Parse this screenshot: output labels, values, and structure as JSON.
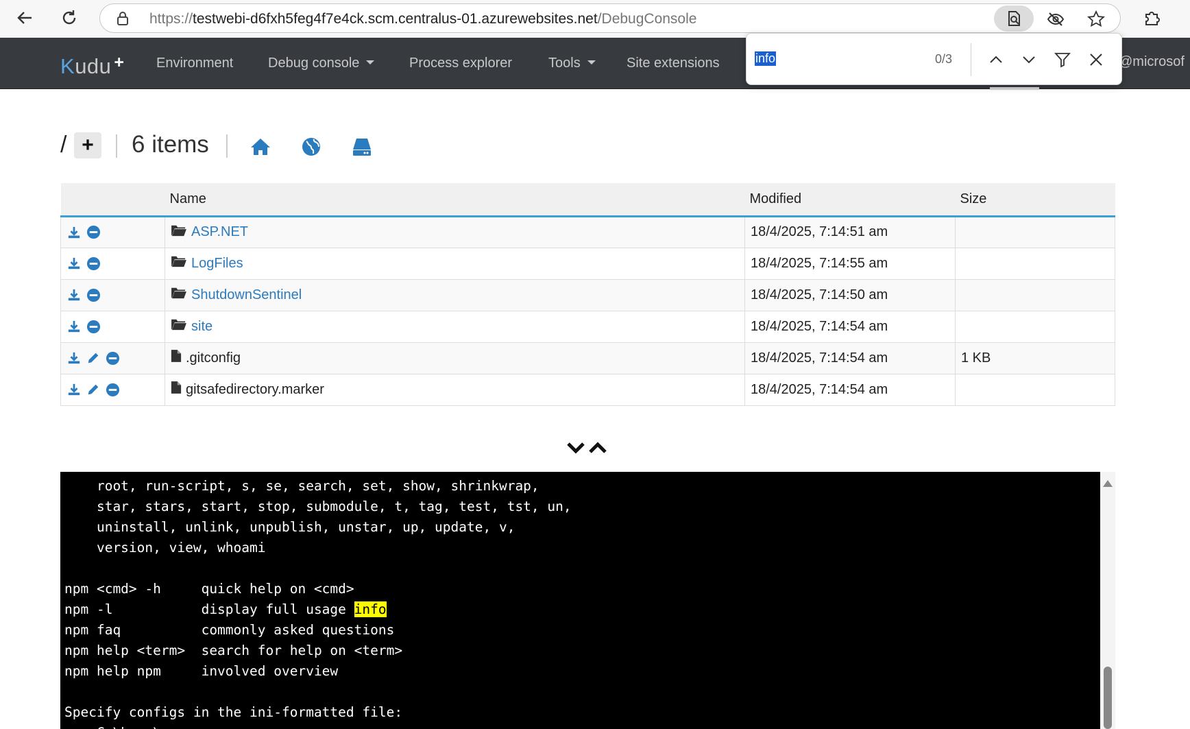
{
  "browser": {
    "url_prefix": "https://",
    "url_host": "testwebi-d6fxh5feg4f7e4ck.scm.centralus-01.azurewebsites.net",
    "url_path": "/DebugConsole",
    "icons": [
      "back-icon",
      "refresh-icon",
      "lock-icon",
      "reader-icon",
      "eye-off-icon",
      "star-icon",
      "extensions-icon"
    ]
  },
  "navbar": {
    "brand_k": "K",
    "brand_rest": "udu",
    "brand_plus": "+",
    "items": [
      {
        "label": "Environment",
        "dropdown": false
      },
      {
        "label": "Debug console",
        "dropdown": true
      },
      {
        "label": "Process explorer",
        "dropdown": false
      },
      {
        "label": "Tools",
        "dropdown": true
      },
      {
        "label": "Site extensions",
        "dropdown": false
      }
    ],
    "user": "@microsof"
  },
  "find": {
    "query": "info",
    "count": "0/3"
  },
  "breadcrumb": {
    "root": "/",
    "add": "+",
    "items_count": "6 items"
  },
  "table": {
    "headers": [
      "Name",
      "Modified",
      "Size"
    ],
    "rows": [
      {
        "type": "folder",
        "name": "ASP.NET",
        "modified": "18/4/2025, 7:14:51 am",
        "size": ""
      },
      {
        "type": "folder",
        "name": "LogFiles",
        "modified": "18/4/2025, 7:14:55 am",
        "size": ""
      },
      {
        "type": "folder",
        "name": "ShutdownSentinel",
        "modified": "18/4/2025, 7:14:50 am",
        "size": ""
      },
      {
        "type": "folder",
        "name": "site",
        "modified": "18/4/2025, 7:14:54 am",
        "size": ""
      },
      {
        "type": "file",
        "name": ".gitconfig",
        "modified": "18/4/2025, 7:14:54 am",
        "size": "1 KB"
      },
      {
        "type": "file",
        "name": "gitsafedirectory.marker",
        "modified": "18/4/2025, 7:14:54 am",
        "size": ""
      }
    ]
  },
  "console": {
    "lines_before": [
      "    root, run-script, s, se, search, set, show, shrinkwrap,",
      "    star, stars, start, stop, submodule, t, tag, test, tst, un,",
      "    uninstall, unlink, unpublish, unstar, up, update, v,",
      "    version, view, whoami",
      "",
      "npm <cmd> -h     quick help on <cmd>"
    ],
    "highlight_line_prefix": "npm -l           display full usage ",
    "highlight_word": "info",
    "lines_after": [
      "npm faq          commonly asked questions",
      "npm help <term>  search for help on <term>",
      "npm help npm     involved overview",
      "",
      "Specify configs in the ini-formatted file:",
      "    C:\\home\\.npmrc"
    ]
  }
}
